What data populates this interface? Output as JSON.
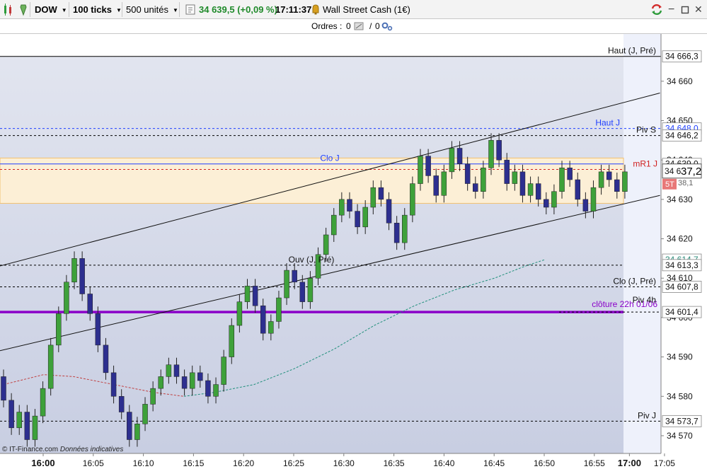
{
  "toolbar": {
    "instrument": "DOW",
    "ticks": "100 ticks",
    "units": "500 unités",
    "price": "34 639,5 (+0,09 %)",
    "time": "17:11:37",
    "market_name": "Wall Street Cash (1€)"
  },
  "orders": {
    "label": "Ordres :",
    "buy_count": "0",
    "sep": "/",
    "sell_count": "0"
  },
  "colors": {
    "up": "#3ea13a",
    "down": "#2d2f8f",
    "accent": "#1f3fff",
    "purple": "#8a00c8"
  },
  "price_labels": [
    {
      "v": 34666.3,
      "t": "34 666,3"
    },
    {
      "v": 34648.0,
      "t": "34 648,0",
      "color": "#1f3fff"
    },
    {
      "v": 34646.2,
      "t": "34 646,2"
    },
    {
      "v": 34639.0,
      "t": "34 639,0"
    },
    {
      "v": 34614.7,
      "t": "34 614,7",
      "color": "#2a8a78"
    },
    {
      "v": 34613.3,
      "t": "34 613,3"
    },
    {
      "v": 34607.8,
      "t": "34 607,8"
    },
    {
      "v": 34601.4,
      "t": "34 601,4"
    },
    {
      "v": 34573.7,
      "t": "34 573,7"
    }
  ],
  "current": {
    "small": "34 6",
    "large": "37,2",
    "badge": "5T",
    "hidden_tail": "38,1"
  },
  "chart_data": {
    "type": "candlestick",
    "y_ticks": [
      "34 570",
      "34 580",
      "34 590",
      "34 600",
      "34 610",
      "34 620",
      "34 630",
      "34 640",
      "34 650",
      "34 660"
    ],
    "y_tick_values": [
      34570,
      34580,
      34590,
      34600,
      34610,
      34620,
      34630,
      34640,
      34650,
      34660
    ],
    "ylim": [
      34565.5,
      34672
    ],
    "x_ticks": [
      {
        "t": "16:00",
        "bold": true,
        "i": 0
      },
      {
        "t": "16:05",
        "i": 10
      },
      {
        "t": "16:10",
        "i": 20
      },
      {
        "t": "16:15",
        "i": 30
      },
      {
        "t": "16:20",
        "i": 40
      },
      {
        "t": "16:25",
        "i": 50
      },
      {
        "t": "16:30",
        "i": 60
      },
      {
        "t": "16:35",
        "i": 70
      },
      {
        "t": "16:40",
        "i": 80
      },
      {
        "t": "16:45",
        "i": 90
      },
      {
        "t": "16:50",
        "i": 100
      },
      {
        "t": "16:55",
        "i": 110
      },
      {
        "t": "17:00",
        "bold": true,
        "i": 117
      },
      {
        "t": "17:05",
        "i": 124
      }
    ],
    "levels": [
      {
        "v": 34666.3,
        "name": "Haut (J, Pré)",
        "style": "solid",
        "color": "#000000"
      },
      {
        "v": 34648.0,
        "name": "Haut J",
        "style": "dashed",
        "color": "#1f3fff"
      },
      {
        "v": 34646.2,
        "name": "Piv S",
        "style": "dashed",
        "color": "#000000"
      },
      {
        "v": 34639.0,
        "name": "Clo J",
        "style": "solid",
        "color": "#1f3fff"
      },
      {
        "v": 34637.6,
        "name": "mR1 J",
        "style": "dashed",
        "color": "#d02020"
      },
      {
        "v": 34613.3,
        "name": "Ouv (J, Pré)",
        "style": "dashed",
        "color": "#000000"
      },
      {
        "v": 34607.8,
        "name": "Clo (J, Pré)",
        "style": "dashed",
        "color": "#000000"
      },
      {
        "v": 34601.4,
        "name": "clôture 22h 01/06",
        "style": "solid",
        "color": "#8a00c8"
      },
      {
        "v": 34601.4,
        "name": "Piv 4h",
        "style": "dashed",
        "color": "#000000"
      },
      {
        "v": 34573.7,
        "name": "Piv J",
        "style": "dashed",
        "color": "#000000"
      }
    ],
    "zone": [
      34629.0,
      34640.5
    ],
    "candles": [
      [
        34585,
        34579
      ],
      [
        34579,
        34572
      ],
      [
        34572,
        34576
      ],
      [
        34576,
        34569
      ],
      [
        34569,
        34575
      ],
      [
        34575,
        34582
      ],
      [
        34582,
        34593
      ],
      [
        34593,
        34601
      ],
      [
        34601,
        34609
      ],
      [
        34609,
        34615
      ],
      [
        34615,
        34606
      ],
      [
        34606,
        34601
      ],
      [
        34601,
        34593
      ],
      [
        34593,
        34586
      ],
      [
        34586,
        34580
      ],
      [
        34580,
        34576
      ],
      [
        34576,
        34569
      ],
      [
        34569,
        34573
      ],
      [
        34573,
        34578
      ],
      [
        34578,
        34582
      ],
      [
        34582,
        34585
      ],
      [
        34585,
        34588
      ],
      [
        34588,
        34585
      ],
      [
        34585,
        34582
      ],
      [
        34582,
        34586
      ],
      [
        34586,
        34584
      ],
      [
        34584,
        34580
      ],
      [
        34580,
        34583
      ],
      [
        34583,
        34590
      ],
      [
        34590,
        34598
      ],
      [
        34598,
        34604
      ],
      [
        34604,
        34608
      ],
      [
        34608,
        34603
      ],
      [
        34603,
        34596
      ],
      [
        34596,
        34599
      ],
      [
        34599,
        34605
      ],
      [
        34605,
        34612
      ],
      [
        34612,
        34609
      ],
      [
        34609,
        34604
      ],
      [
        34604,
        34610
      ],
      [
        34610,
        34616
      ],
      [
        34616,
        34621
      ],
      [
        34621,
        34626
      ],
      [
        34626,
        34630
      ],
      [
        34630,
        34627
      ],
      [
        34627,
        34623
      ],
      [
        34623,
        34628
      ],
      [
        34628,
        34633
      ],
      [
        34633,
        34630
      ],
      [
        34630,
        34624
      ],
      [
        34624,
        34619
      ],
      [
        34619,
        34626
      ],
      [
        34626,
        34634
      ],
      [
        34634,
        34641
      ],
      [
        34641,
        34636
      ],
      [
        34636,
        34631
      ],
      [
        34631,
        34637
      ],
      [
        34637,
        34643
      ],
      [
        34643,
        34639
      ],
      [
        34639,
        34634
      ],
      [
        34634,
        34632
      ],
      [
        34632,
        34638
      ],
      [
        34638,
        34645
      ],
      [
        34645,
        34640
      ],
      [
        34640,
        34634
      ],
      [
        34634,
        34637
      ],
      [
        34637,
        34631
      ],
      [
        34631,
        34634
      ],
      [
        34634,
        34630
      ],
      [
        34630,
        34628
      ],
      [
        34628,
        34632
      ],
      [
        34632,
        34638
      ],
      [
        34638,
        34635
      ],
      [
        34635,
        34630
      ],
      [
        34630,
        34627
      ],
      [
        34627,
        34633
      ],
      [
        34633,
        34637
      ],
      [
        34637,
        34635
      ],
      [
        34635,
        34632
      ],
      [
        34632,
        34637
      ]
    ],
    "ma_red": [
      [
        0,
        34583
      ],
      [
        8,
        34585.5
      ],
      [
        14,
        34585
      ],
      [
        22,
        34583
      ],
      [
        30,
        34581
      ],
      [
        36,
        34580
      ]
    ],
    "ma_teal": [
      [
        36,
        34580
      ],
      [
        42,
        34581
      ],
      [
        50,
        34583
      ],
      [
        58,
        34587
      ],
      [
        66,
        34592
      ],
      [
        74,
        34598
      ],
      [
        82,
        34603
      ],
      [
        90,
        34607
      ],
      [
        98,
        34610
      ],
      [
        104,
        34613
      ],
      [
        108,
        34614.7
      ]
    ]
  }
}
